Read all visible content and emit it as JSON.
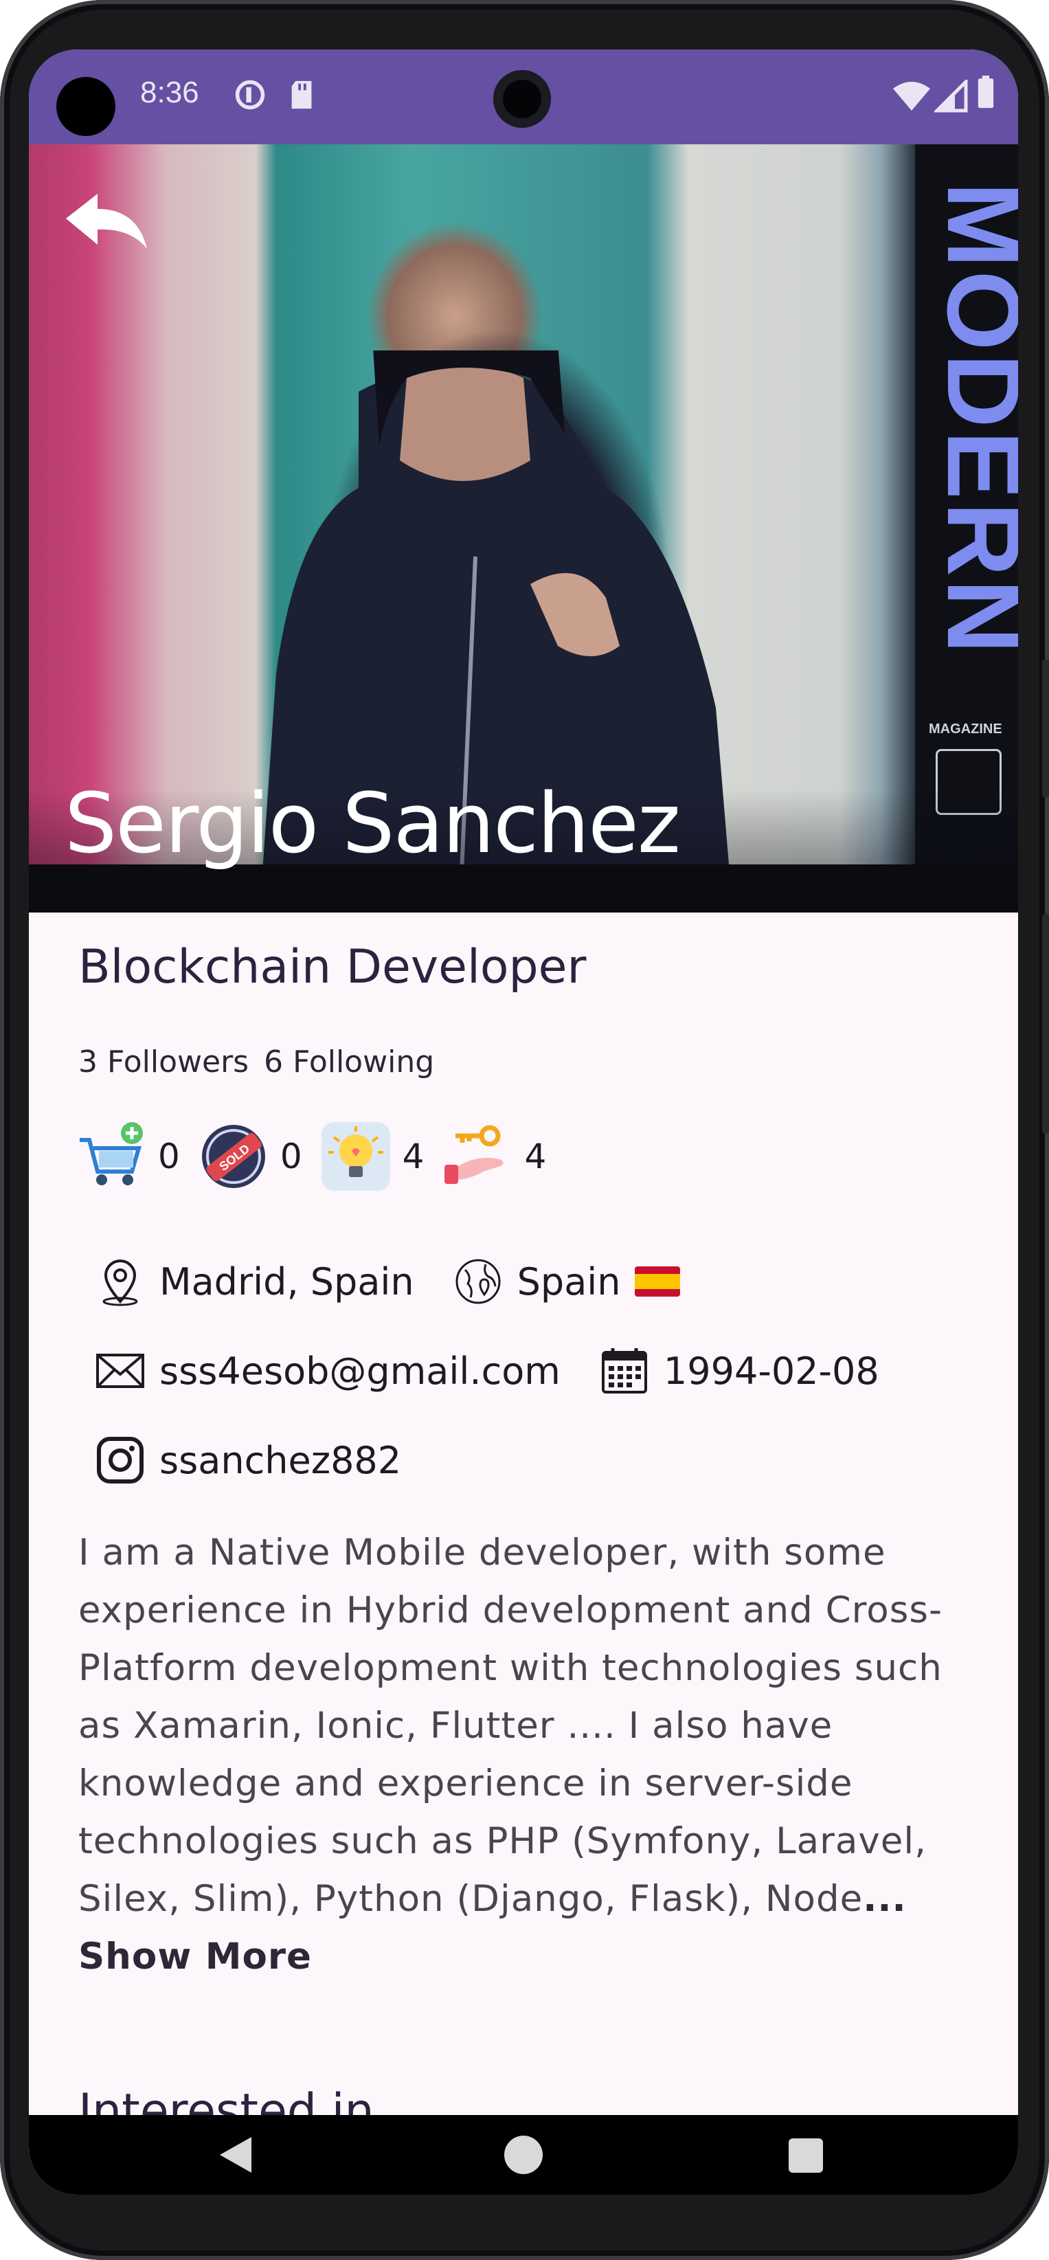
{
  "status_bar": {
    "time": "8:36"
  },
  "profile": {
    "name": "Sergio Sanchez",
    "job_title": "Blockchain Developer",
    "followers_label": "3 Followers",
    "following_label": "6 Following"
  },
  "hero": {
    "magazine_word": "MODERN",
    "magazine_small": "MAGAZINE"
  },
  "stats": [
    {
      "icon": "cart-add-icon",
      "value": "0"
    },
    {
      "icon": "sold-badge-icon",
      "value": "0"
    },
    {
      "icon": "lightbulb-icon",
      "value": "4"
    },
    {
      "icon": "hand-key-icon",
      "value": "4"
    }
  ],
  "info": {
    "city": "Madrid, Spain",
    "country": "Spain",
    "email": "sss4esob@gmail.com",
    "birthdate": "1994-02-08",
    "instagram": "ssanchez882"
  },
  "bio": {
    "text": "I am a Native Mobile developer, with some experience in Hybrid development and Cross-Platform development with technologies such as Xamarin, Ionic, Flutter .... I also have knowledge and experience in server-side technologies such as PHP (Symfony, Laravel, Silex, Slim), Python (Django, Flask), Node",
    "show_more": "... Show More"
  },
  "sections": {
    "interested_in": "Interested in"
  },
  "colors": {
    "status_bar": "#6550a4",
    "background": "#fdf7fb",
    "title": "#2a2340"
  }
}
